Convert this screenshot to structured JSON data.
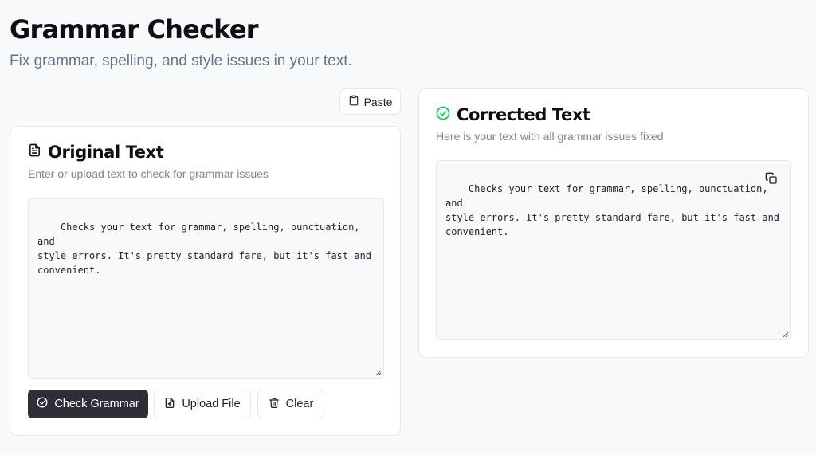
{
  "header": {
    "title": "Grammar Checker",
    "subtitle": "Fix grammar, spelling, and style issues in your text."
  },
  "toolbar": {
    "paste_label": "Paste",
    "paste_icon": "clipboard-icon"
  },
  "original": {
    "icon": "document-icon",
    "title": "Original Text",
    "description": "Enter or upload text to check for grammar issues",
    "text": "Checks your text for grammar, spelling, punctuation, and\nstyle errors. It's pretty standard fare, but it's fast and\nconvenient.",
    "buttons": {
      "check": "Check Grammar",
      "upload": "Upload File",
      "clear": "Clear"
    }
  },
  "corrected": {
    "icon": "check-circle-icon",
    "icon_color": "#22c55e",
    "title": "Corrected Text",
    "description": "Here is your text with all grammar issues fixed",
    "text": "Checks your text for grammar, spelling, punctuation, and\nstyle errors. It's pretty standard fare, but it's fast and\nconvenient.",
    "copy_icon": "copy-icon"
  },
  "colors": {
    "primary_button": "#2d2e36",
    "muted_text": "#687387",
    "background": "#f8f9fb"
  }
}
